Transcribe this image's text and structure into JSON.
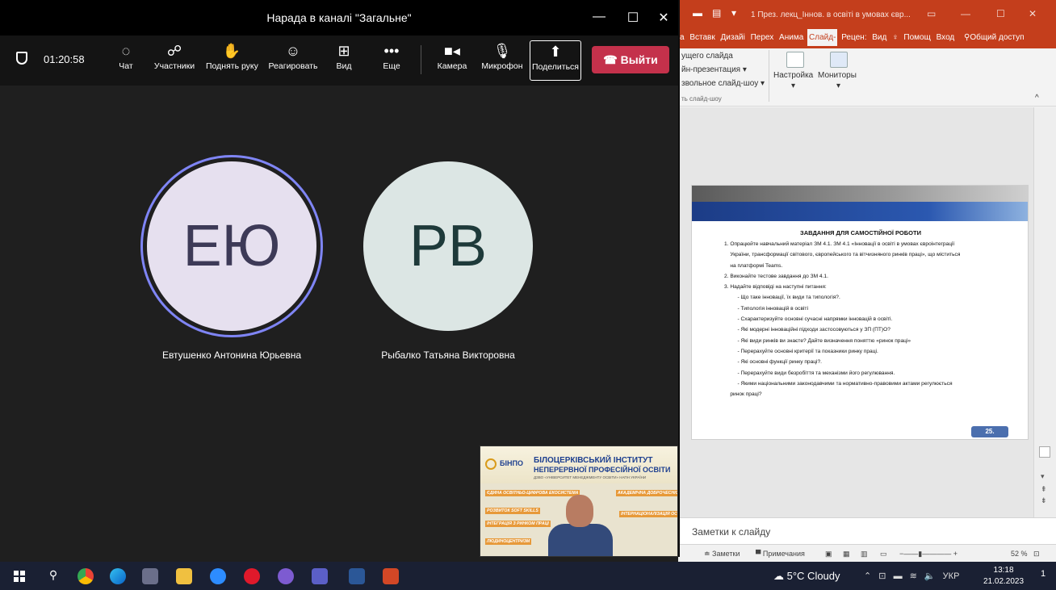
{
  "teams": {
    "title": "Нарада в каналі \"Загальне\"",
    "timer": "01:20:58",
    "toolbar": [
      {
        "id": "chat",
        "label": "Чат",
        "icon": "chat-icon"
      },
      {
        "id": "people",
        "label": "Участники",
        "icon": "people-icon"
      },
      {
        "id": "raise-hand",
        "label": "Поднять руку",
        "icon": "hand-icon"
      },
      {
        "id": "react",
        "label": "Реагировать",
        "icon": "smile-icon"
      },
      {
        "id": "view",
        "label": "Вид",
        "icon": "grid-icon"
      },
      {
        "id": "more",
        "label": "Еще",
        "icon": "more-icon"
      },
      {
        "id": "camera",
        "label": "Камера",
        "icon": "camera-icon"
      },
      {
        "id": "mic",
        "label": "Микрофон",
        "icon": "mic-icon"
      },
      {
        "id": "share",
        "label": "Поделиться",
        "icon": "share-icon"
      }
    ],
    "leave_label": "Выйти",
    "participants": [
      {
        "initials": "ЕЮ",
        "name": "Евтушенко Антонина Юрьевна",
        "bg": "#e6e0ef",
        "fg": "#3d3a57",
        "speaking": true
      },
      {
        "initials": "РВ",
        "name": "Рыбалко Татьяна Викторовна",
        "bg": "#dce6e4",
        "fg": "#1e3a3a",
        "speaking": false
      }
    ],
    "ring_color": "#7f85f5",
    "video": {
      "logo": "БІНПО",
      "line1": "БІЛОЦЕРКІВСЬКИЙ ІНСТИТУТ",
      "line2": "НЕПЕРЕРВНОЇ ПРОФЕСІЙНОЇ ОСВІТИ",
      "line3": "ДЗВО «УНІВЕРСИТЕТ МЕНЕДЖМЕНТУ ОСВІТИ» НАПН УКРАЇНИ",
      "keywords": [
        "ЄДИНА ОСВІТНЬО-ЦИФРОВА ЕКОСИСТЕМА",
        "РОЗВИТОК SOFT SKILLS",
        "ІНТЕГРАЦІЯ З РИНКОМ ПРАЦІ",
        "ЛЮДИНОЦЕНТРИЗМ",
        "АКАДЕМІЧНА ДОБРОЧЕСНІСТЬ",
        "ІНТЕРНАЦІОНАЛІЗАЦІЯ ОСВІТИ"
      ]
    }
  },
  "ppt": {
    "file_title": "1 През. лекц_Іннов. в освіті в умовах євр...",
    "tabs": [
      "а",
      "Вставк",
      "Дизайі",
      "Перех",
      "Анима",
      "Слайд-",
      "Рецен:",
      "Вид",
      "Помощ",
      "Вход"
    ],
    "active_tab_index": 5,
    "share_label": "Общий доступ",
    "ribbon": {
      "from_current": "ущего слайда",
      "online": "йн-презентация",
      "custom": "звольное слайд-шоу",
      "group": "ть слайд-шоу",
      "setup": "Настройка",
      "monitors": "Мониторы"
    },
    "slide": {
      "title": "ЗАВДАННЯ ДЛЯ САМОСТІЙНОЇ РОБОТИ",
      "items": [
        "1. Опрацюйте навчальний матеріал ЗМ 4.1. ЗМ 4.1 «Інновації в освіті в умовах євроінтеграції",
        "    України, трансформації світового, європейського та вітчизняного ринків праці», що міститься",
        "    на платформі Teams.",
        "2. Виконайте тестове завдання до ЗМ 4.1.",
        "3. Надайте відповіді на наступні питання:",
        "         - Що таке інновації, їх види та типологія?.",
        "         - Типологія інновацій в освіті",
        "         - Схарактеризуйте основні сучасні напрямки інновацій в освіті.",
        "         - Які модерні інноваційні підходи застосовуються у ЗП (ПТ)О?",
        "         - Які види ринків ви знаєте? Дайте визначення поняттю «ринок праці»",
        "         - Перерахуйте основні критерії та показники ринку праці.",
        "         - Які основні функції ринку праці?.",
        "         - Перерахуйте види безробіття та механізми його регулювання.",
        "         - Якими національними законодавчими та нормативно-правовими актами регулюється",
        "    ринок праці?"
      ],
      "number": "25."
    },
    "notes_placeholder": "Заметки к слайду",
    "status": {
      "notes": "Заметки",
      "comments": "Примечания",
      "zoom": "52 %"
    }
  },
  "taskbar": {
    "weather": "5°C  Cloudy",
    "lang": "УКР",
    "time": "13:18",
    "date": "21.02.2023",
    "notif_count": "1",
    "apps": [
      "windows-start-icon",
      "search-icon",
      "chrome-icon",
      "edge-icon",
      "photo-app-icon",
      "file-explorer-icon",
      "zoom-icon",
      "opera-icon",
      "viber-icon",
      "teams-icon",
      "word-icon",
      "powerpoint-icon"
    ]
  }
}
